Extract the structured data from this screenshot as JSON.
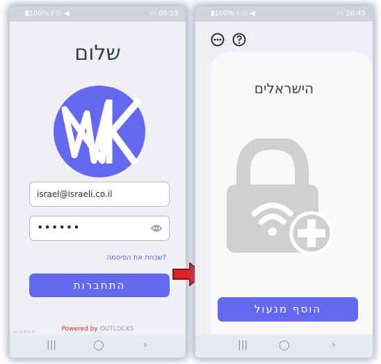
{
  "screen1": {
    "status_left": "▮100% ⅈ ☉ ◀",
    "status_right": "▭ 09:55",
    "greeting": "שלום",
    "email_value": "israel@israeli.co.il",
    "password_mask": "••••••",
    "forgot_password": "שכחת את הסיסמה?",
    "login_button": "התחברות",
    "powered_by": "Powered by",
    "brand": "OUTLOCKS",
    "version": "v1.0.8.0.4",
    "logo_colors": {
      "circle": "#6468ef",
      "letters": "#ffffff"
    }
  },
  "screen2": {
    "status_left": "▮100% ⅈ ☉ ◀",
    "status_right": "▭ 10:45",
    "title": "הישראלים",
    "add_lock_button": "הוסף מנעול",
    "icons": [
      "more-icon",
      "help-icon"
    ]
  },
  "navbar": {
    "recents": "|||",
    "home": "◯",
    "back": "›"
  },
  "colors": {
    "accent": "#6468ef",
    "arrow": "#e0212b",
    "lock": "#d0d0d0"
  }
}
